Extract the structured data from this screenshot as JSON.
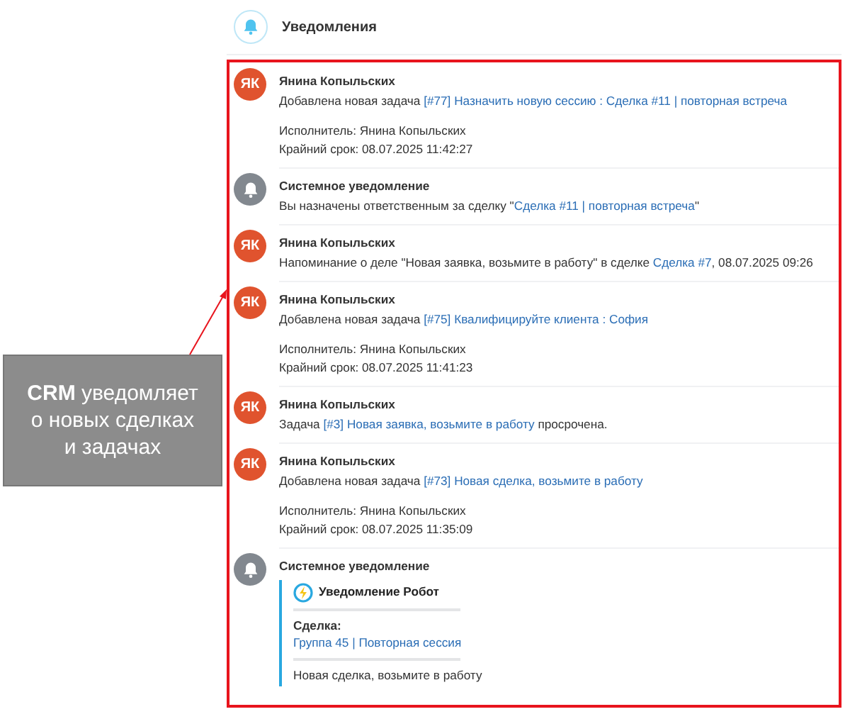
{
  "callout": {
    "text": "**CRM** уведомляет о новых сделках и задачах"
  },
  "header": {
    "title": "Уведомления"
  },
  "notifications": [
    {
      "kind": "user",
      "initials": "ЯК",
      "author": "Янина Копыльских",
      "message": [
        {
          "kind": "text",
          "text": "Добавлена новая задача "
        },
        {
          "kind": "link",
          "text": "[#77] Назначить новую сессию : Сделка #11 | повторная встреча"
        }
      ],
      "details": [
        "Исполнитель: Янина Копыльских",
        "Крайний срок: 08.07.2025 11:42:27"
      ]
    },
    {
      "kind": "system",
      "author": "Системное уведомление",
      "message": [
        {
          "kind": "text",
          "text": "Вы назначены ответственным за сделку \""
        },
        {
          "kind": "link",
          "text": "Сделка #11 | повторная встреча"
        },
        {
          "kind": "text",
          "text": "\""
        }
      ]
    },
    {
      "kind": "user",
      "initials": "ЯК",
      "author": "Янина Копыльских",
      "message": [
        {
          "kind": "text",
          "text": "Напоминание о деле \"Новая заявка, возьмите в работу\" в сделке "
        },
        {
          "kind": "link",
          "text": "Сделка #7"
        },
        {
          "kind": "text",
          "text": ", 08.07.2025 09:26"
        }
      ]
    },
    {
      "kind": "user",
      "initials": "ЯК",
      "author": "Янина Копыльских",
      "message": [
        {
          "kind": "text",
          "text": "Добавлена новая задача "
        },
        {
          "kind": "link",
          "text": "[#75] Квалифицируйте клиента : София"
        }
      ],
      "details": [
        "Исполнитель: Янина Копыльских",
        "Крайний срок: 08.07.2025 11:41:23"
      ]
    },
    {
      "kind": "user",
      "initials": "ЯК",
      "author": "Янина Копыльских",
      "message": [
        {
          "kind": "text",
          "text": "Задача "
        },
        {
          "kind": "link",
          "text": "[#3] Новая заявка, возьмите в работу"
        },
        {
          "kind": "text",
          "text": " просрочена."
        }
      ]
    },
    {
      "kind": "user",
      "initials": "ЯК",
      "author": "Янина Копыльских",
      "message": [
        {
          "kind": "text",
          "text": "Добавлена новая задача "
        },
        {
          "kind": "link",
          "text": "[#73] Новая сделка, возьмите в работу"
        }
      ],
      "details": [
        "Исполнитель: Янина Копыльских",
        "Крайний срок: 08.07.2025 11:35:09"
      ]
    },
    {
      "kind": "system",
      "author": "Системное уведомление",
      "card": {
        "title": "Уведомление Робот",
        "field_label": "Сделка:",
        "field_link": "Группа 45 | Повторная сессия",
        "note": "Новая сделка, возьмите в работу"
      }
    }
  ]
}
